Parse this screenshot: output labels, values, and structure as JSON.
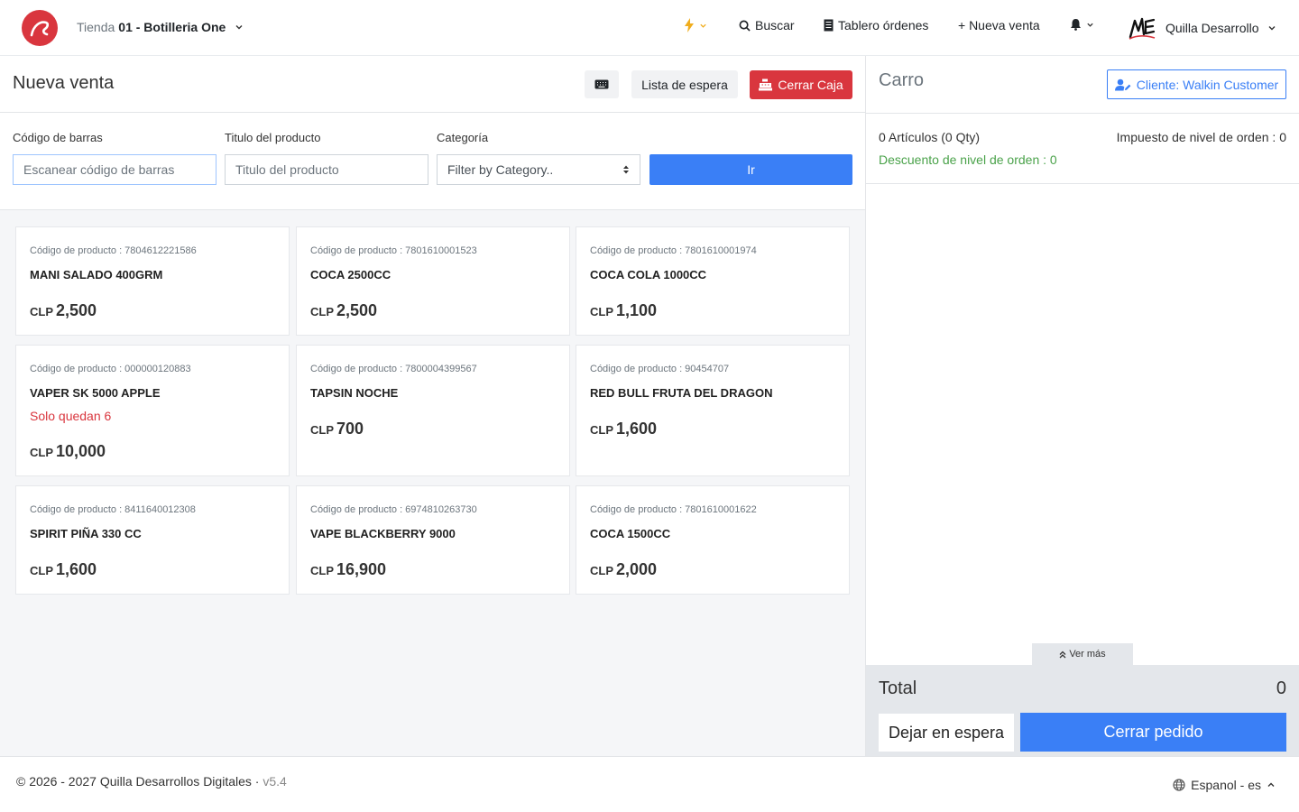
{
  "header": {
    "store_prefix": "Tienda",
    "store_number": "01 - Botilleria One",
    "search_label": "Buscar",
    "board_label": "Tablero órdenes",
    "new_sale_label": "+ Nueva venta",
    "user_name": "Quilla Desarrollo"
  },
  "sale": {
    "title": "Nueva venta",
    "wait_list_label": "Lista de espera",
    "close_cash_label": "Cerrar Caja"
  },
  "filters": {
    "barcode_label": "Código de barras",
    "barcode_placeholder": "Escanear código de barras",
    "title_label": "Titulo del producto",
    "title_placeholder": "Titulo del producto",
    "category_label": "Categoría",
    "category_value": "Filter by Category..",
    "go_label": "Ir"
  },
  "products": [
    {
      "code": "Código de producto : 7804612221586",
      "name": "MANI SALADO 400GRM",
      "currency": "CLP",
      "price": "2,500",
      "stock": ""
    },
    {
      "code": "Código de producto : 7801610001523",
      "name": "COCA 2500CC",
      "currency": "CLP",
      "price": "2,500",
      "stock": ""
    },
    {
      "code": "Código de producto : 7801610001974",
      "name": "COCA COLA 1000CC",
      "currency": "CLP",
      "price": "1,100",
      "stock": ""
    },
    {
      "code": "Código de producto : 000000120883",
      "name": "VAPER SK 5000 APPLE",
      "currency": "CLP",
      "price": "10,000",
      "stock": "Solo quedan 6"
    },
    {
      "code": "Código de producto : 7800004399567",
      "name": "TAPSIN NOCHE",
      "currency": "CLP",
      "price": "700",
      "stock": ""
    },
    {
      "code": "Código de producto : 90454707",
      "name": "RED BULL FRUTA DEL DRAGON",
      "currency": "CLP",
      "price": "1,600",
      "stock": ""
    },
    {
      "code": "Código de producto : 8411640012308",
      "name": "SPIRIT PIÑA 330 CC",
      "currency": "CLP",
      "price": "1,600",
      "stock": ""
    },
    {
      "code": "Código de producto : 6974810263730",
      "name": "VAPE BLACKBERRY 9000",
      "currency": "CLP",
      "price": "16,900",
      "stock": ""
    },
    {
      "code": "Código de producto : 7801610001622",
      "name": "COCA 1500CC",
      "currency": "CLP",
      "price": "2,000",
      "stock": ""
    }
  ],
  "cart": {
    "title": "Carro",
    "client_label": "Cliente: Walkin Customer",
    "items_count": "0 Artículos (0 Qty)",
    "order_tax": "Impuesto de nivel de orden : 0",
    "order_discount": "Descuento de nivel de orden : 0",
    "see_more_label": "Ver más",
    "total_label": "Total",
    "total_value": "0",
    "hold_label": "Dejar en espera",
    "checkout_label": "Cerrar pedido"
  },
  "footer": {
    "copyright": "© 2026 - 2027 Quilla Desarrollos Digitales · ",
    "version": "v5.4",
    "language": "Espanol - es"
  },
  "colors": {
    "primary": "#3a7ff6",
    "danger": "#d9363e",
    "success": "#4aa24a",
    "warning": "#f0ad1d"
  }
}
